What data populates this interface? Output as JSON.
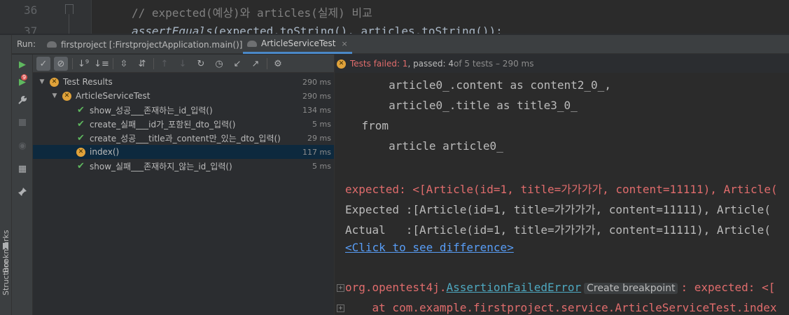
{
  "editor": {
    "lines": [
      {
        "number": "36",
        "code": "// expected(예상)와 articles(실제) 비교"
      },
      {
        "number": "37",
        "code_fn": "assertEquals",
        "code_rest": "(expected.toString(), articles.toString());"
      }
    ]
  },
  "side_stripe": {
    "bookmarks_label": "Bookmarks",
    "structure_label": "Structure"
  },
  "run": {
    "label": "Run:",
    "tabs": [
      {
        "label": "firstproject [:FirstprojectApplication.main()]",
        "active": false
      },
      {
        "label": "ArticleServiceTest",
        "active": true,
        "close": "×"
      }
    ]
  },
  "toolbar": {
    "vertical": [
      {
        "icon": "run-icon",
        "glyph": "▶"
      },
      {
        "icon": "rerun-failed-icon",
        "glyph": "▶",
        "badge": "9"
      },
      {
        "icon": "wrench-icon",
        "glyph": "🔧"
      },
      {
        "icon": "stop-icon",
        "glyph": "■"
      },
      {
        "icon": "eye-icon",
        "glyph": "◉"
      },
      {
        "icon": "layout-icon",
        "glyph": "▦"
      },
      {
        "icon": "pin-icon",
        "glyph": "📌"
      }
    ]
  },
  "tree": {
    "rows": [
      {
        "label": "Test Results",
        "time": "290 ms",
        "status": "failed"
      },
      {
        "label": "ArticleServiceTest",
        "time": "290 ms",
        "status": "failed"
      },
      {
        "label": "show_성공___존재하는_id_입력()",
        "time": "134 ms",
        "status": "passed"
      },
      {
        "label": "create_실패___id가_포함된_dto_입력()",
        "time": "5 ms",
        "status": "passed"
      },
      {
        "label": "create_성공___title과_content만_있는_dto_입력()",
        "time": "29 ms",
        "status": "passed"
      },
      {
        "label": "index()",
        "time": "117 ms",
        "status": "failed",
        "selected": true
      },
      {
        "label": "show_실패___존재하지_않는_id_입력()",
        "time": "5 ms",
        "status": "passed"
      }
    ]
  },
  "console": {
    "summary_failed": "Tests failed: 1",
    "summary_passed": ", passed: 4",
    "summary_rest": " of 5 tests – 290 ms",
    "sql_lines": [
      "        article0_.content as content2_0_,",
      "        article0_.title as title3_0_",
      "    from",
      "        article article0_"
    ],
    "error_lines": [
      "expected: <[Article(id=1, title=가가가가, content=11111), Article(",
      "Expected :[Article(id=1, title=가가가가, content=11111), Article(",
      "Actual   :[Article(id=1, title=가가가가, content=11111), Article("
    ],
    "diff_link": "<Click to see difference>",
    "exception_prefix": "org.opentest4j.",
    "exception_class": "AssertionFailedError",
    "tooltip": "Create breakpoint",
    "exception_suffix": ": expected: <[",
    "stack_line": "    at com.example.firstproject.service.ArticleServiceTest.index"
  }
}
